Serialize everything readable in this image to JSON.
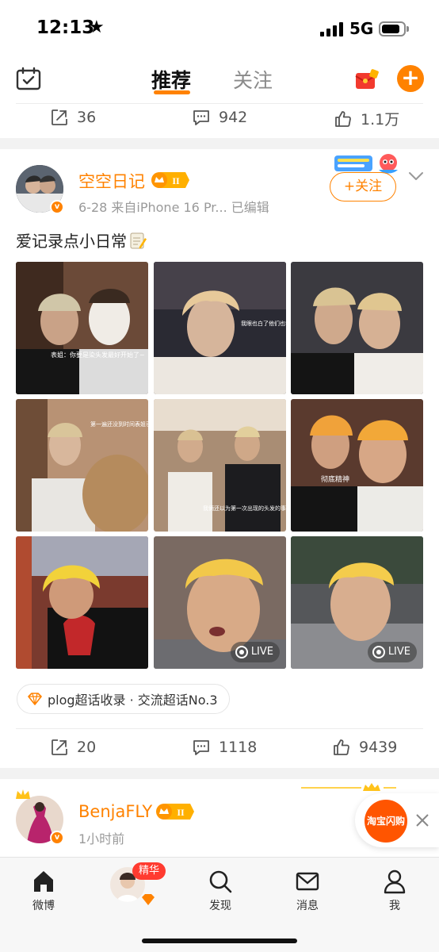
{
  "status_bar": {
    "time": "12:13",
    "network": "5G"
  },
  "top_nav": {
    "tab_recommend": "推荐",
    "tab_follow": "关注"
  },
  "prev_post_actions": {
    "reposts": "36",
    "comments": "942",
    "likes": "1.1万"
  },
  "post": {
    "username": "空空日记",
    "vip_level": "II",
    "meta": "6-28  来自iPhone 16 Pr...  已编辑",
    "follow_label": "+关注",
    "text": "爱记录点小日常",
    "photo_captions": {
      "p1": "表姐：你要是染头发最好开始了~",
      "p2": "我眼也白了他们也都显家到那那都不行",
      "p5": "第一遍还没到时间表姐已按降啦",
      "p6": "彻底精神",
      "p8": "我俩还以为第一次出现的头发的事色"
    },
    "live_label": "LIVE",
    "topic_tag": "plog超话收录 · 交流超话No.3",
    "actions": {
      "reposts": "20",
      "comments": "1118",
      "likes": "9439"
    }
  },
  "next_post": {
    "username": "BenjaFLY",
    "vip_level": "II",
    "meta": "1小时前"
  },
  "floating": {
    "taobao_label": "淘宝闪购"
  },
  "bottom_nav": {
    "home": "微博",
    "featured_badge": "精华",
    "discover": "发现",
    "messages": "消息",
    "me": "我"
  },
  "colors": {
    "accent": "#ff8200",
    "text": "#222222",
    "muted": "#9a9a9a"
  }
}
